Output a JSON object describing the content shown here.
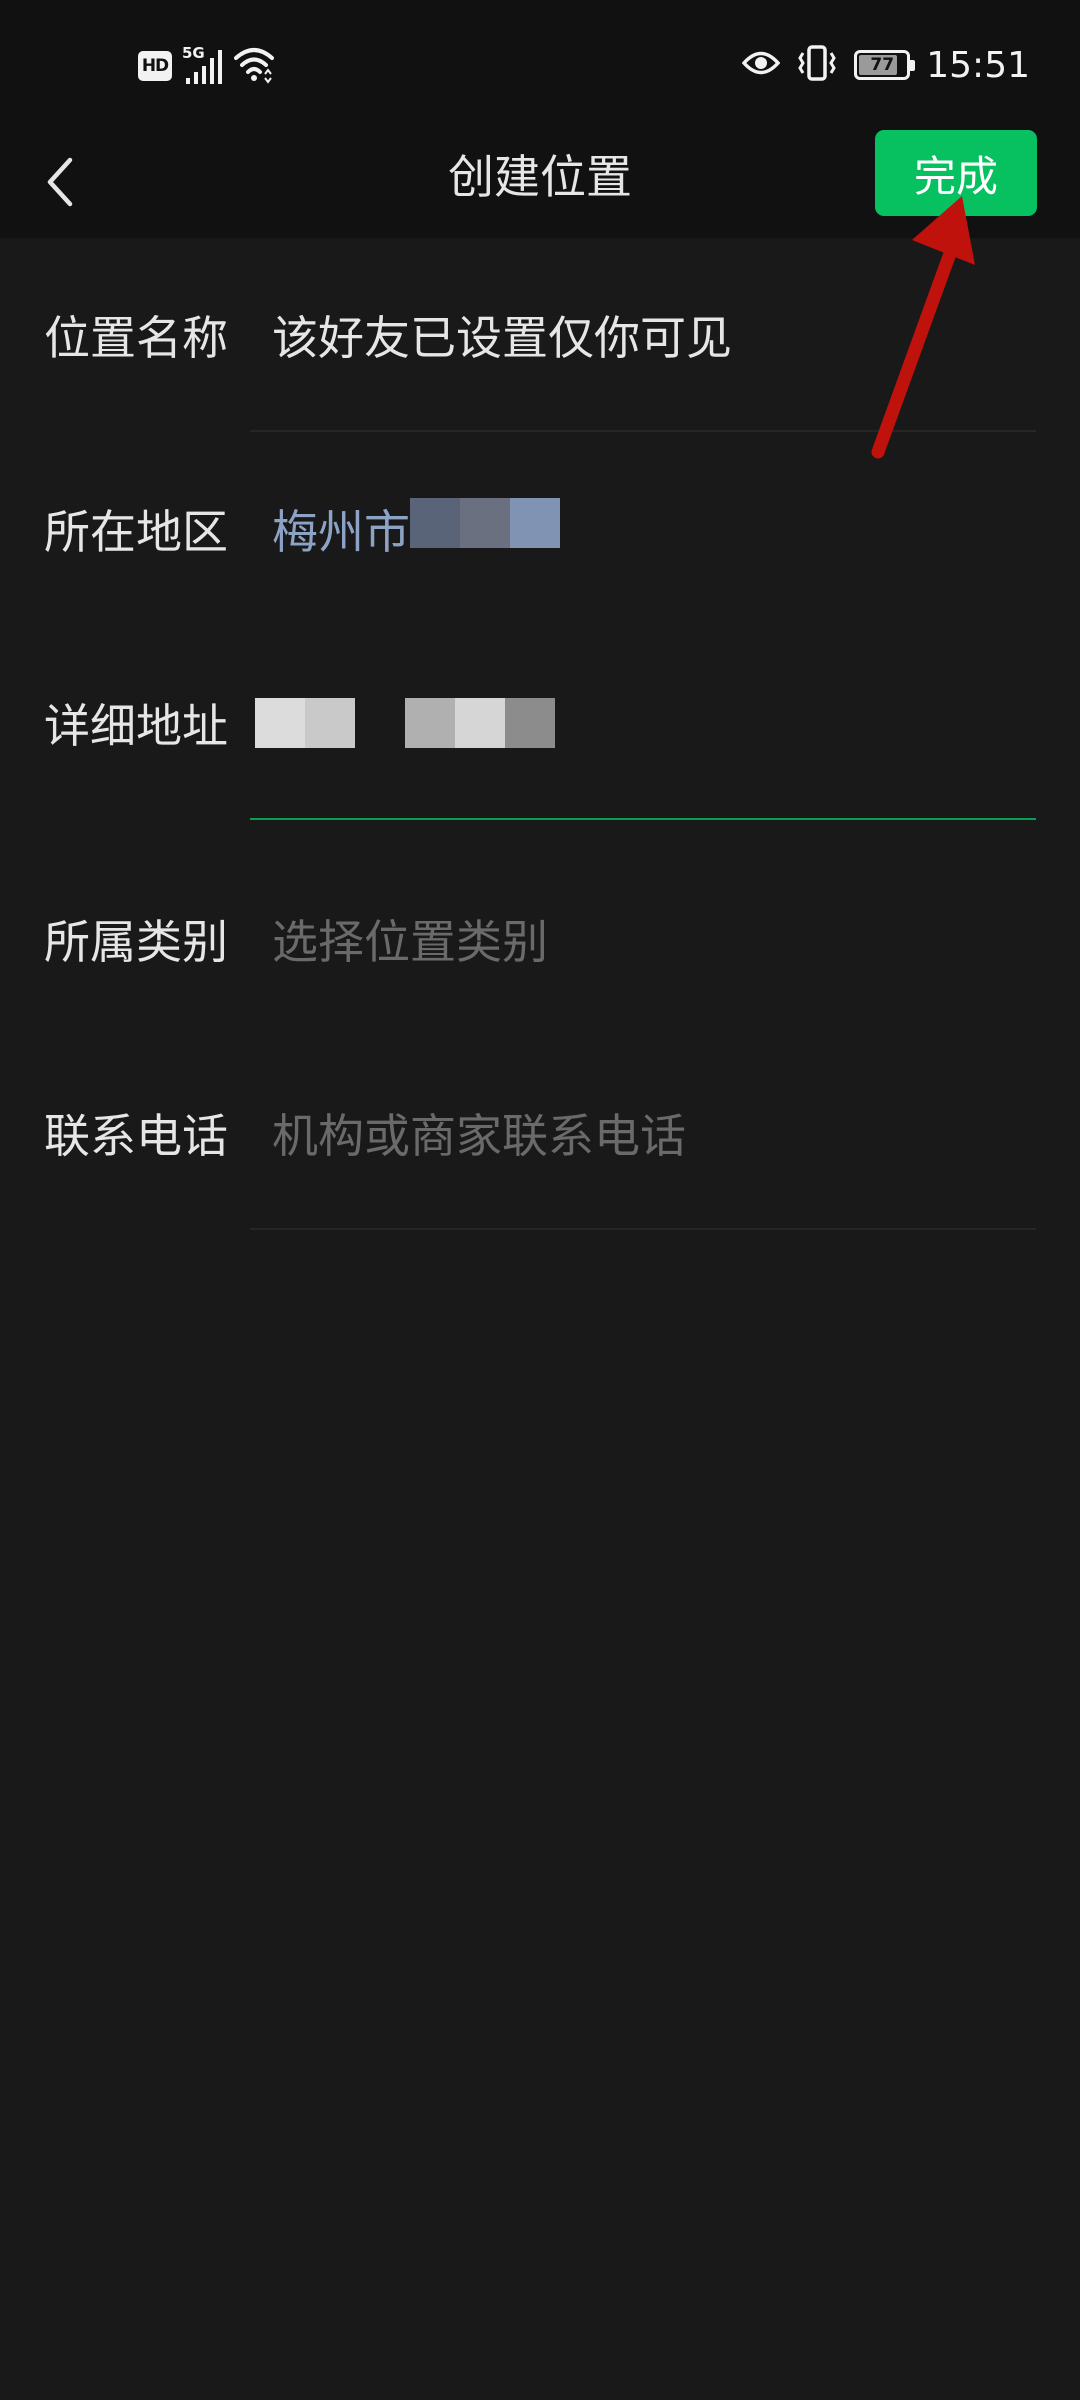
{
  "status_bar": {
    "hd": "HD",
    "network": "5G",
    "battery": "77",
    "time": "15:51"
  },
  "header": {
    "title": "创建位置",
    "done_label": "完成"
  },
  "form": {
    "rows": [
      {
        "label": "位置名称",
        "value": "该好友已设置仅你可见",
        "state": "filled"
      },
      {
        "label": "所在地区",
        "value": "梅州市",
        "state": "link"
      },
      {
        "label": "详细地址",
        "value": "",
        "state": "focused"
      },
      {
        "label": "所属类别",
        "placeholder": "选择位置类别",
        "state": "placeholder"
      },
      {
        "label": "联系电话",
        "placeholder": "机构或商家联系电话",
        "state": "placeholder"
      }
    ]
  },
  "colors": {
    "background": "#191919",
    "bar": "#111111",
    "accent": "#07c160",
    "link": "#8da3c6",
    "annotation": "#c0120c"
  },
  "icons": {
    "back": "chevron-left-icon",
    "signal": "signal-bars-icon",
    "wifi": "wifi-icon",
    "eye": "eye-icon",
    "vibrate": "vibrate-icon",
    "battery": "battery-icon"
  }
}
